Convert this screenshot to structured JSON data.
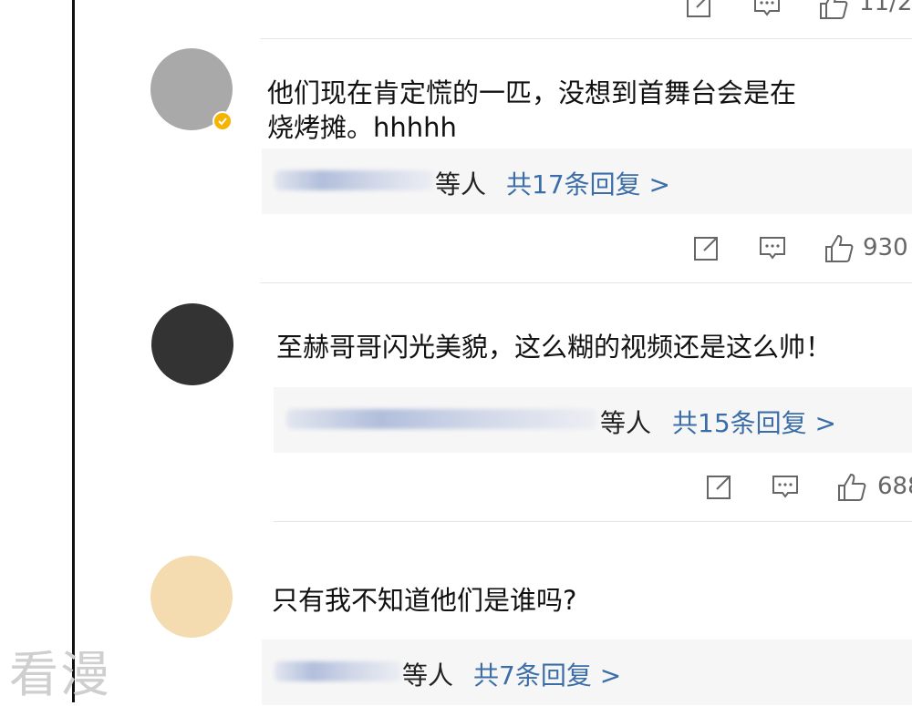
{
  "watermark": "看漫",
  "top_partial": {
    "like_count": "11/2"
  },
  "comments": [
    {
      "text_line1": "他们现在肯定慌的一匹，没想到首舞台会是在",
      "text_line2": "烧烤摊。hhhhh",
      "reply_etc": "等人",
      "reply_count": "共17条回复 >",
      "like_count": "930",
      "avatar_color": "#a9a9a9",
      "verified": true
    },
    {
      "text_line1": "至赫哥哥闪光美貌，这么糊的视频还是这么帅！",
      "reply_etc": "等人",
      "reply_count": "共15条回复 >",
      "like_count": "688",
      "avatar_color": "#333333"
    },
    {
      "text_line1": "只有我不知道他们是谁吗?",
      "reply_etc": "等人",
      "reply_count": "共7条回复 >",
      "avatar_color": "#f4dcb0"
    }
  ],
  "icons": [
    "share-icon",
    "comment-icon",
    "like-icon",
    "verified-badge-icon"
  ],
  "colors": {
    "link": "#3b6ea8",
    "badge": "#f5b400",
    "reply_bg": "#f6f6f6"
  }
}
